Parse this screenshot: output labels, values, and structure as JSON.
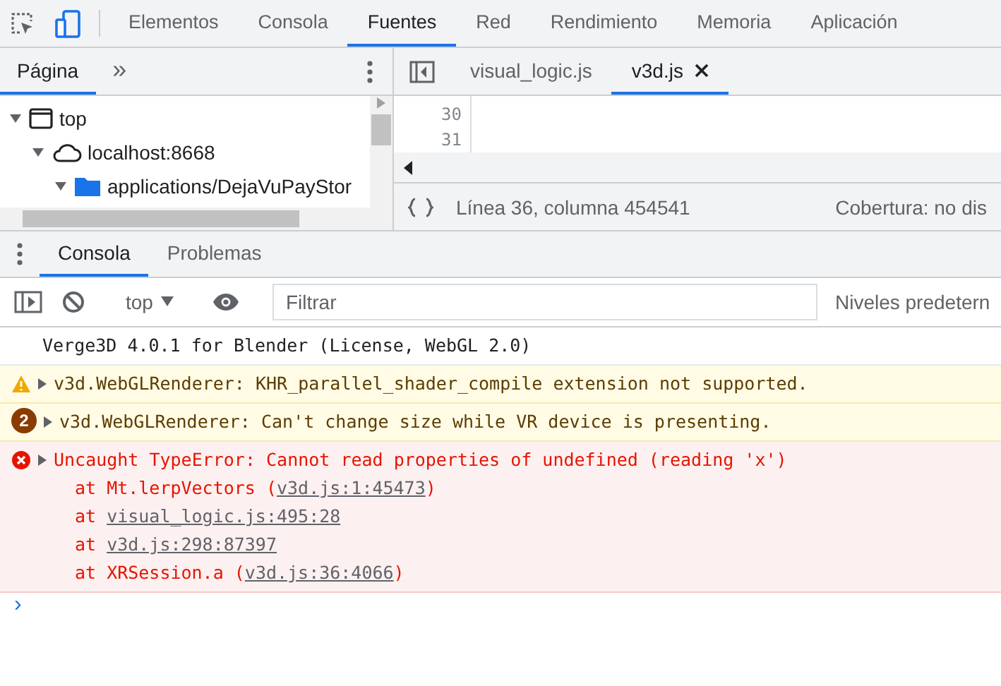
{
  "main_tabs": [
    {
      "label": "Elementos",
      "selected": false
    },
    {
      "label": "Consola",
      "selected": false
    },
    {
      "label": "Fuentes",
      "selected": true
    },
    {
      "label": "Red",
      "selected": false
    },
    {
      "label": "Rendimiento",
      "selected": false
    },
    {
      "label": "Memoria",
      "selected": false
    },
    {
      "label": "Aplicación",
      "selected": false
    }
  ],
  "navigator": {
    "tabs": [
      {
        "label": "Página",
        "selected": true
      }
    ],
    "more": "»",
    "tree": [
      {
        "kind": "frame",
        "label": "top",
        "expanded": true,
        "children": [
          {
            "kind": "domain",
            "label": "localhost:8668",
            "expanded": true,
            "children": [
              {
                "kind": "folder",
                "label": "applications/DejaVuPayStor",
                "expanded": true
              }
            ]
          }
        ]
      }
    ]
  },
  "editor": {
    "tabs": [
      {
        "label": "visual_logic.js",
        "selected": false,
        "closable": false
      },
      {
        "label": "v3d.js",
        "selected": true,
        "closable": true
      }
    ],
    "line_numbers": [
      "30",
      "31"
    ],
    "status": {
      "position": "Línea 36, columna 454541",
      "coverage": "Cobertura: no dis"
    }
  },
  "drawer": {
    "tabs": [
      {
        "label": "Consola",
        "selected": true
      },
      {
        "label": "Problemas",
        "selected": false
      }
    ]
  },
  "console_toolbar": {
    "context": "top",
    "filter": {
      "placeholder": "Filtrar"
    },
    "levels": "Niveles predetern"
  },
  "messages": [
    {
      "kind": "info",
      "text": "Verge3D 4.0.1 for Blender (License, WebGL 2.0)"
    },
    {
      "kind": "warning",
      "text": "v3d.WebGLRenderer: KHR_parallel_shader_compile extension not supported."
    },
    {
      "kind": "warning",
      "count": "2",
      "text": "v3d.WebGLRenderer: Can't change size while VR device is presenting."
    },
    {
      "kind": "error",
      "text": "Uncaught TypeError: Cannot read properties of undefined (reading 'x')",
      "frames": [
        {
          "before": "at Mt.lerpVectors (",
          "link": "v3d.js:1:45473",
          "after": ")"
        },
        {
          "before": "at ",
          "link": "visual_logic.js:495:28"
        },
        {
          "before": "at ",
          "link": "v3d.js:298:87397"
        },
        {
          "before": "at XRSession.a (",
          "link": "v3d.js:36:4066",
          "after": ")"
        }
      ]
    }
  ],
  "prompt": "›"
}
